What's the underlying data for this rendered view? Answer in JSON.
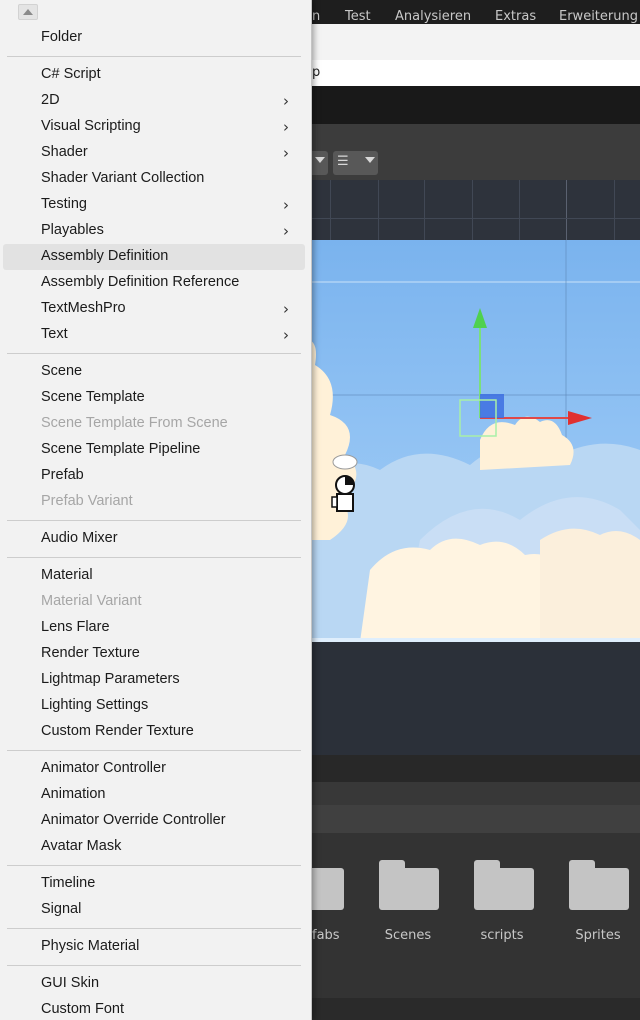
{
  "editor": {
    "menubar": [
      "n",
      "Test",
      "Analysieren",
      "Extras",
      "Erweiterung"
    ],
    "address_fragment": "p",
    "project_folders": [
      "fabs",
      "Scenes",
      "scripts",
      "Sprites"
    ]
  },
  "menu": {
    "scroll_up_icon": "triangle-up-icon",
    "submenu_icon": "chevron-right-icon",
    "groups": [
      [
        {
          "label": "Folder"
        }
      ],
      [
        {
          "label": "C# Script"
        },
        {
          "label": "2D",
          "submenu": true
        },
        {
          "label": "Visual Scripting",
          "submenu": true
        },
        {
          "label": "Shader",
          "submenu": true
        },
        {
          "label": "Shader Variant Collection"
        },
        {
          "label": "Testing",
          "submenu": true
        },
        {
          "label": "Playables",
          "submenu": true
        },
        {
          "label": "Assembly Definition",
          "highlighted": true
        },
        {
          "label": "Assembly Definition Reference"
        },
        {
          "label": "TextMeshPro",
          "submenu": true
        },
        {
          "label": "Text",
          "submenu": true
        }
      ],
      [
        {
          "label": "Scene"
        },
        {
          "label": "Scene Template"
        },
        {
          "label": "Scene Template From Scene",
          "disabled": true
        },
        {
          "label": "Scene Template Pipeline"
        },
        {
          "label": "Prefab"
        },
        {
          "label": "Prefab Variant",
          "disabled": true
        }
      ],
      [
        {
          "label": "Audio Mixer"
        }
      ],
      [
        {
          "label": "Material"
        },
        {
          "label": "Material Variant",
          "disabled": true
        },
        {
          "label": "Lens Flare"
        },
        {
          "label": "Render Texture"
        },
        {
          "label": "Lightmap Parameters"
        },
        {
          "label": "Lighting Settings"
        },
        {
          "label": "Custom Render Texture"
        }
      ],
      [
        {
          "label": "Animator Controller"
        },
        {
          "label": "Animation"
        },
        {
          "label": "Animator Override Controller"
        },
        {
          "label": "Avatar Mask"
        }
      ],
      [
        {
          "label": "Timeline"
        },
        {
          "label": "Signal"
        }
      ],
      [
        {
          "label": "Physic Material"
        }
      ],
      [
        {
          "label": "GUI Skin"
        },
        {
          "label": "Custom Font"
        }
      ]
    ]
  }
}
